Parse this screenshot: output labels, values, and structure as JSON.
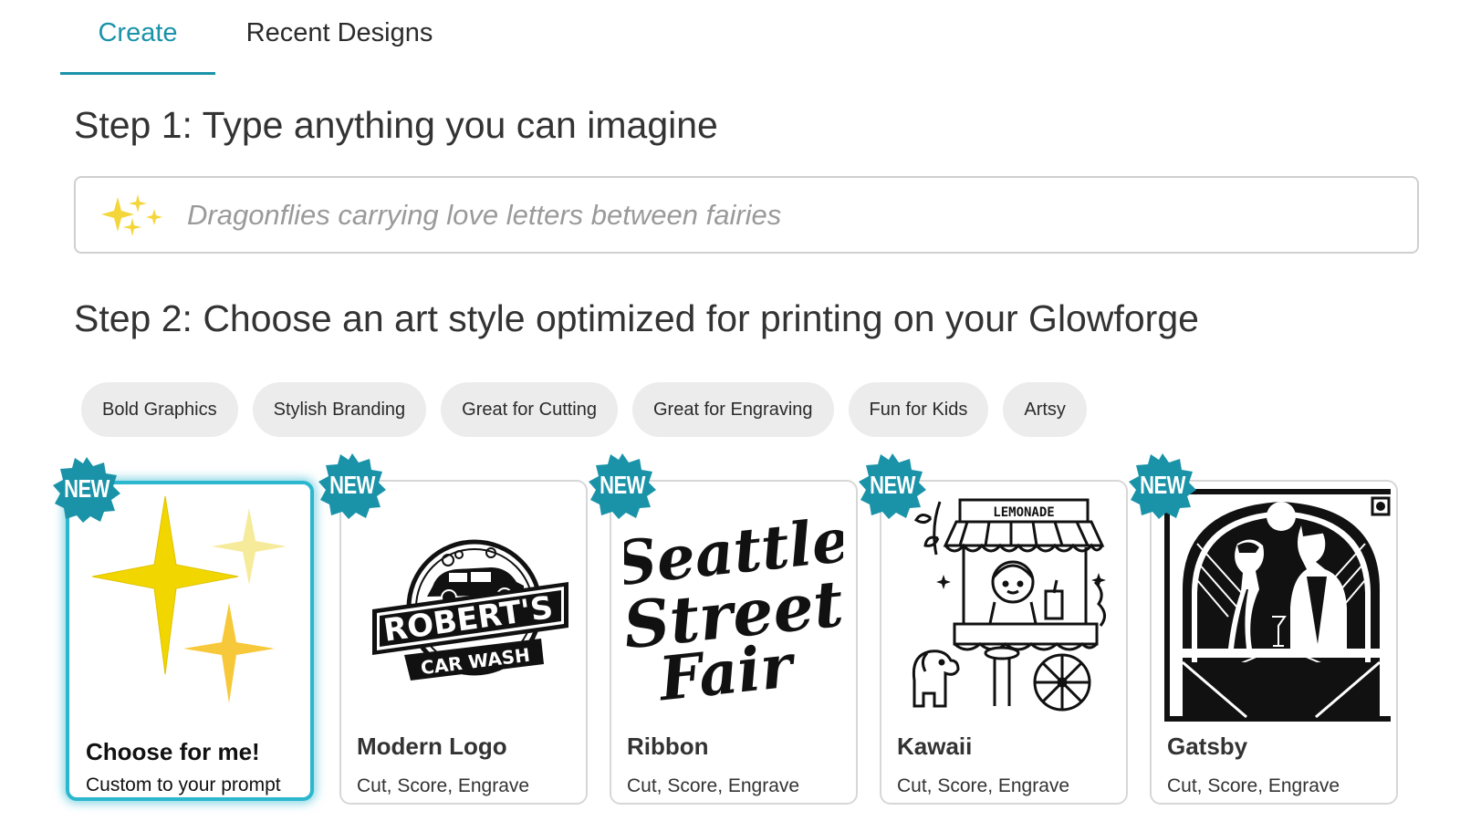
{
  "tabs": [
    {
      "label": "Create",
      "active": true
    },
    {
      "label": "Recent Designs",
      "active": false
    }
  ],
  "step1": {
    "title": "Step 1: Type anything you can imagine",
    "input_placeholder": "Dragonflies carrying love letters between fairies",
    "input_value": "",
    "icon": "sparkles-icon"
  },
  "step2": {
    "title": "Step 2: Choose an art style optimized for printing on your Glowforge"
  },
  "chips": [
    "Bold Graphics",
    "Stylish Branding",
    "Great for Cutting",
    "Great for Engraving",
    "Fun for Kids",
    "Artsy"
  ],
  "badge_label": "NEW",
  "cards": [
    {
      "title": "Choose for me!",
      "subtitle": "Custom to your prompt",
      "selected": true,
      "badge": "NEW",
      "image": "sparkles-icon"
    },
    {
      "title": "Modern Logo",
      "subtitle": "Cut, Score, Engrave",
      "selected": false,
      "badge": "NEW",
      "image": "car-wash-logo-image",
      "image_text": [
        "ROBERT'S",
        "CAR WASH"
      ]
    },
    {
      "title": "Ribbon",
      "subtitle": "Cut, Score, Engrave",
      "selected": false,
      "badge": "NEW",
      "image": "script-lettering-image",
      "image_text": [
        "Seattle",
        "Street",
        "Fair"
      ]
    },
    {
      "title": "Kawaii",
      "subtitle": "Cut, Score, Engrave",
      "selected": false,
      "badge": "NEW",
      "image": "lemonade-stand-image",
      "image_text": [
        "LEMONADE"
      ]
    },
    {
      "title": "Gatsby",
      "subtitle": "Cut, Score, Engrave",
      "selected": false,
      "badge": "NEW",
      "image": "art-deco-couple-image"
    }
  ],
  "colors": {
    "accent": "#1a93a8",
    "selected_border": "#2cb7cf",
    "badge": "#1a93a8",
    "chip_bg": "#ececec",
    "sparkle_yellow": "#f2d600"
  }
}
